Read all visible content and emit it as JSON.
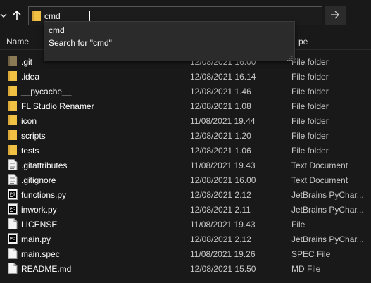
{
  "address_bar": {
    "value": "cmd"
  },
  "suggestions": [
    {
      "label": "cmd"
    },
    {
      "label": "Search for \"cmd\""
    }
  ],
  "columns": {
    "name": "Name",
    "type": "pe"
  },
  "files": [
    {
      "name": ".git",
      "date": "12/08/2021 16.00",
      "type": "File folder",
      "icon": "folder-hidden-icon"
    },
    {
      "name": ".idea",
      "date": "12/08/2021 16.14",
      "type": "File folder",
      "icon": "folder-icon"
    },
    {
      "name": "__pycache__",
      "date": "12/08/2021 1.46",
      "type": "File folder",
      "icon": "folder-icon"
    },
    {
      "name": "FL Studio Renamer",
      "date": "12/08/2021 1.08",
      "type": "File folder",
      "icon": "folder-icon"
    },
    {
      "name": "icon",
      "date": "11/08/2021 19.44",
      "type": "File folder",
      "icon": "folder-icon"
    },
    {
      "name": "scripts",
      "date": "12/08/2021 1.20",
      "type": "File folder",
      "icon": "folder-icon"
    },
    {
      "name": "tests",
      "date": "12/08/2021 1.06",
      "type": "File folder",
      "icon": "folder-icon"
    },
    {
      "name": ".gitattributes",
      "date": "11/08/2021 19.43",
      "type": "Text Document",
      "icon": "text-document-icon"
    },
    {
      "name": ".gitignore",
      "date": "12/08/2021 16.00",
      "type": "Text Document",
      "icon": "text-document-icon"
    },
    {
      "name": "functions.py",
      "date": "12/08/2021 2.12",
      "type": "JetBrains PyChar...",
      "icon": "pycharm-file-icon"
    },
    {
      "name": "inwork.py",
      "date": "12/08/2021 2.11",
      "type": "JetBrains PyChar...",
      "icon": "pycharm-file-icon"
    },
    {
      "name": "LICENSE",
      "date": "11/08/2021 19.43",
      "type": "File",
      "icon": "blank-file-icon"
    },
    {
      "name": "main.py",
      "date": "12/08/2021 2.12",
      "type": "JetBrains PyChar...",
      "icon": "pycharm-file-icon"
    },
    {
      "name": "main.spec",
      "date": "11/08/2021 19.26",
      "type": "SPEC File",
      "icon": "blank-file-icon"
    },
    {
      "name": "README.md",
      "date": "12/08/2021 15.50",
      "type": "MD File",
      "icon": "blank-file-icon"
    }
  ],
  "colors": {
    "background": "#191919",
    "folder": "#f0c143",
    "folder_dark": "#dba93a",
    "suggestion_bg": "#2b2b2b"
  }
}
